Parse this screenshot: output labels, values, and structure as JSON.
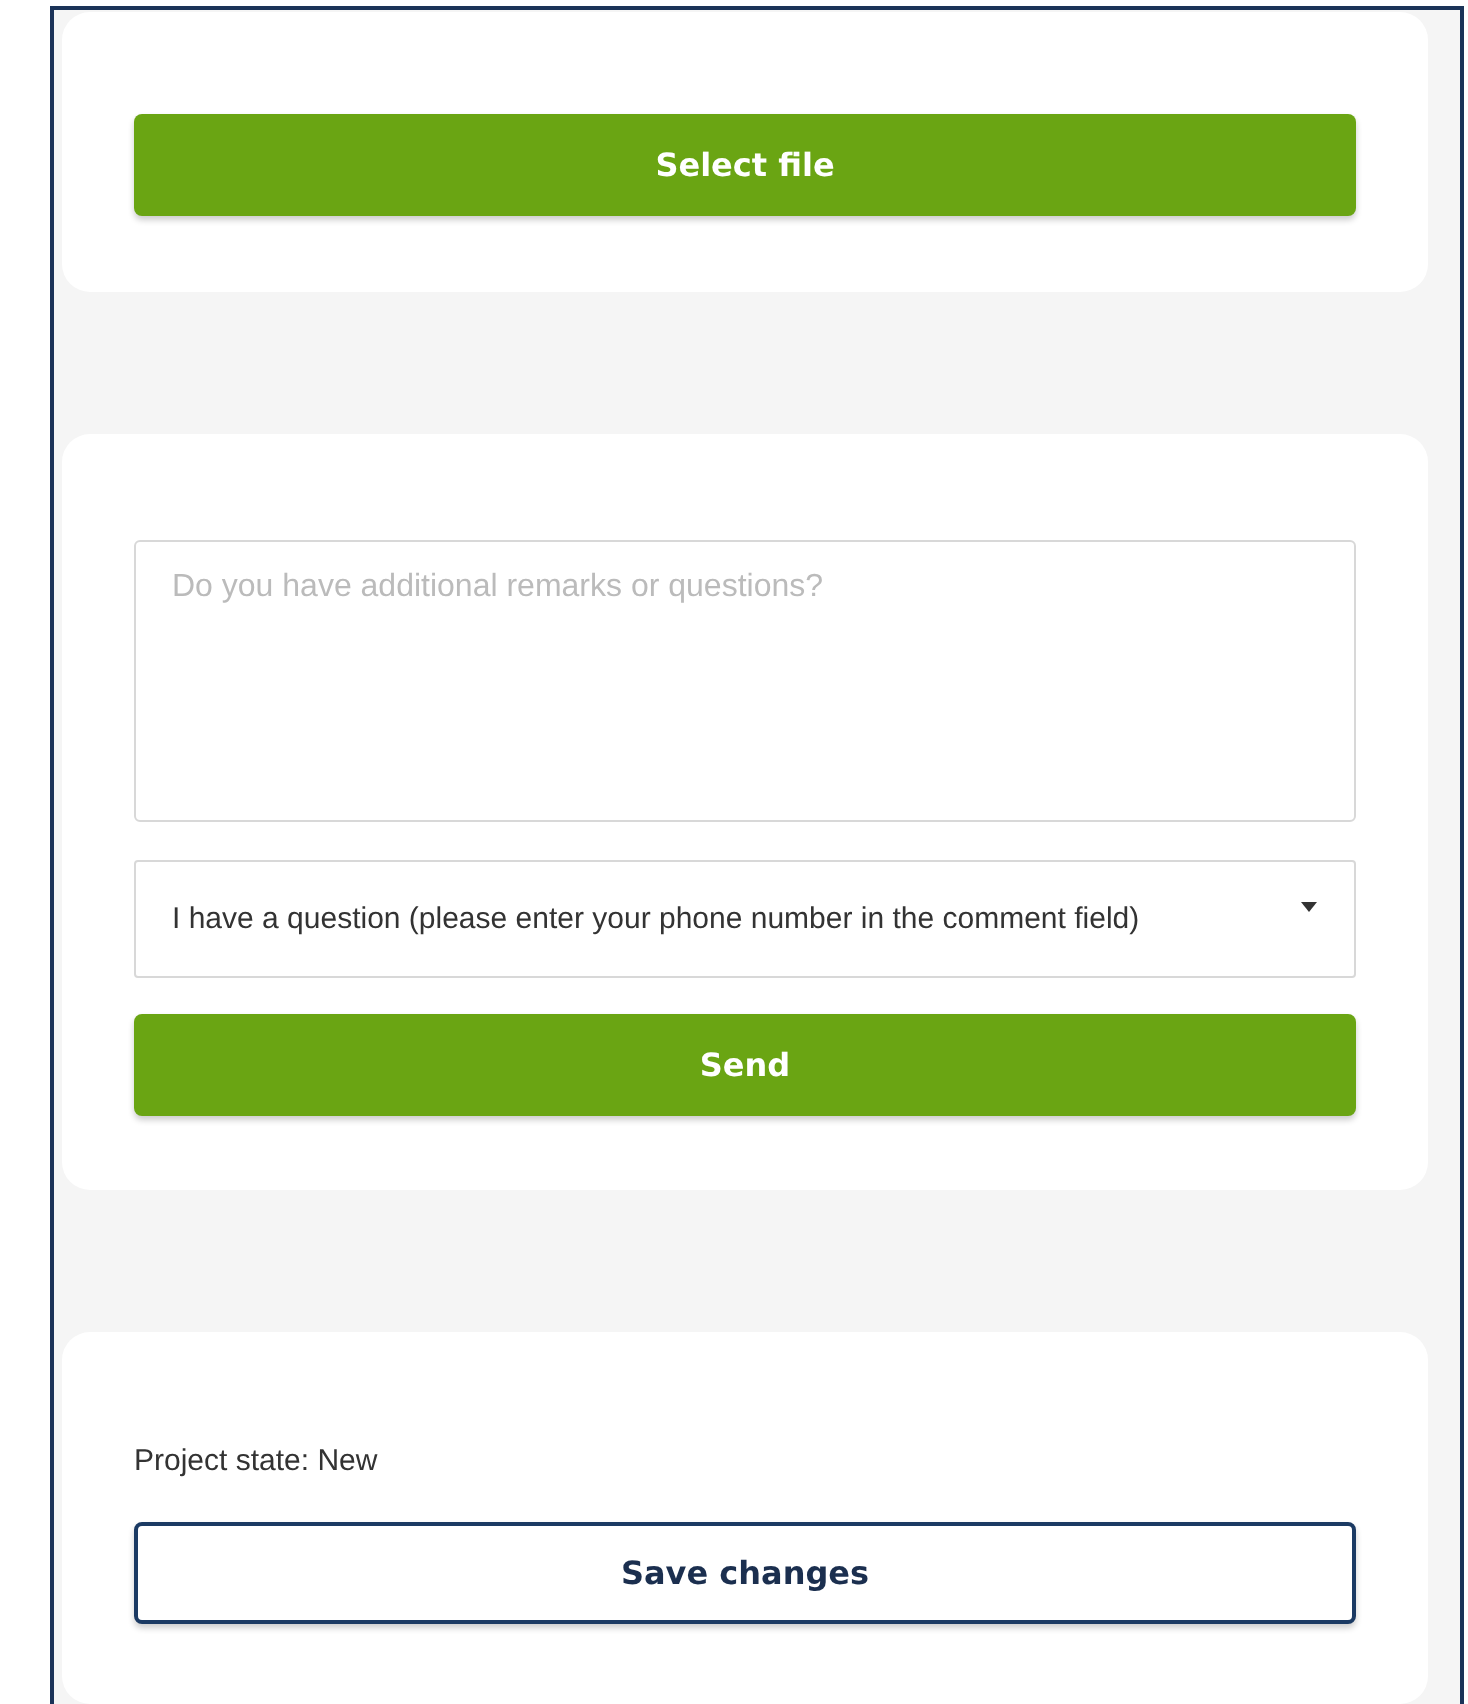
{
  "upload_card": {
    "button": "Select file"
  },
  "message_card": {
    "comment": {
      "placeholder": "Do you have additional remarks or questions?"
    },
    "topic": {
      "value": "I have a question (please enter your phone number in the comment field)"
    },
    "button": "Send"
  },
  "project_card": {
    "state_text": "Project state: New",
    "button": "Save changes"
  }
}
